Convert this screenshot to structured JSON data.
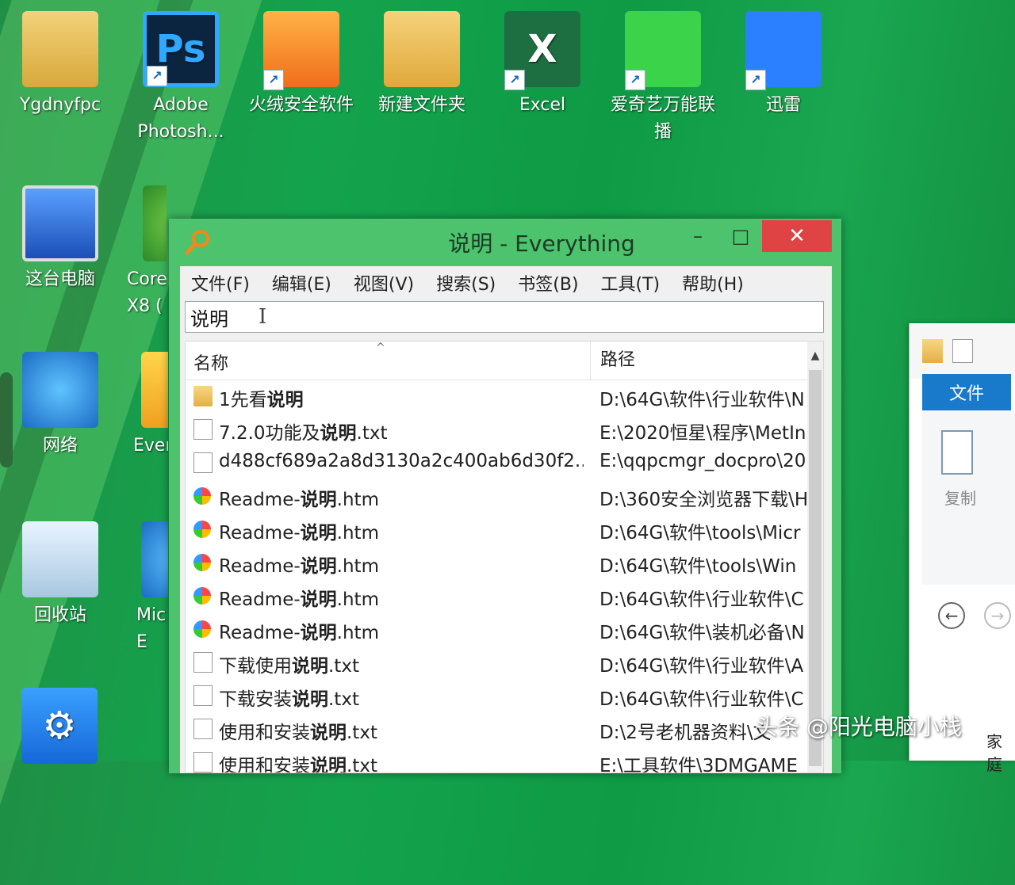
{
  "desktop": {
    "icons": [
      {
        "label": "Ygdnyfpc",
        "icon": "user-folder-icon"
      },
      {
        "label": "Adobe Photosh...",
        "icon": "photoshop-icon",
        "glyph": "Ps"
      },
      {
        "label": "火绒安全软件",
        "icon": "huorong-icon"
      },
      {
        "label": "新建文件夹",
        "icon": "folder-icon"
      },
      {
        "label": "Excel",
        "icon": "excel-icon",
        "glyph": "X"
      },
      {
        "label": "爱奇艺万能联播",
        "icon": "iqiyi-icon"
      },
      {
        "label": "迅雷",
        "icon": "xunlei-icon"
      },
      {
        "label": "这台电脑",
        "icon": "this-pc-icon"
      },
      {
        "label": "Core X8 (",
        "icon": "coreldraw-icon"
      },
      {
        "label": "网络",
        "icon": "network-icon"
      },
      {
        "label": "Ever",
        "icon": "everything-shortcut-icon"
      },
      {
        "label": "回收站",
        "icon": "recycle-bin-icon"
      },
      {
        "label": "Mic E",
        "icon": "edge-icon"
      }
    ]
  },
  "window": {
    "title": "说明 - Everything",
    "controls": {
      "minimize": "–",
      "maximize": "□",
      "close": "✕"
    },
    "menu": [
      "文件(F)",
      "编辑(E)",
      "视图(V)",
      "搜索(S)",
      "书签(B)",
      "工具(T)",
      "帮助(H)"
    ],
    "search": {
      "value": "说明",
      "caret": "I"
    },
    "columns": {
      "name": "名称",
      "path": "路径",
      "sort_indicator": "^"
    },
    "results": [
      {
        "pre": "1先看",
        "bold": "说明",
        "post": "",
        "path": "D:\\64G\\软件\\行业软件\\N",
        "type": "folder"
      },
      {
        "pre": "7.2.0功能及",
        "bold": "说明",
        "post": ".txt",
        "path": "E:\\2020恒星\\程序\\MetIn",
        "type": "txt"
      },
      {
        "pre": "d488cf689a2a8d3130a2c400ab6d30f2...",
        "bold": "",
        "post": "",
        "path": "E:\\qqpcmgr_docpro\\20",
        "type": "file"
      },
      {
        "pre": "Readme-",
        "bold": "说明",
        "post": ".htm",
        "path": "D:\\360安全浏览器下载\\H",
        "type": "htm"
      },
      {
        "pre": "Readme-",
        "bold": "说明",
        "post": ".htm",
        "path": "D:\\64G\\软件\\tools\\Micr",
        "type": "htm"
      },
      {
        "pre": "Readme-",
        "bold": "说明",
        "post": ".htm",
        "path": "D:\\64G\\软件\\tools\\Win",
        "type": "htm"
      },
      {
        "pre": "Readme-",
        "bold": "说明",
        "post": ".htm",
        "path": "D:\\64G\\软件\\行业软件\\C",
        "type": "htm"
      },
      {
        "pre": "Readme-",
        "bold": "说明",
        "post": ".htm",
        "path": "D:\\64G\\软件\\装机必备\\N",
        "type": "htm"
      },
      {
        "pre": "下载使用",
        "bold": "说明",
        "post": ".txt",
        "path": "D:\\64G\\软件\\行业软件\\A",
        "type": "txt"
      },
      {
        "pre": "下载安装",
        "bold": "说明",
        "post": ".txt",
        "path": "D:\\64G\\软件\\行业软件\\C",
        "type": "txt"
      },
      {
        "pre": "使用和安装",
        "bold": "说明",
        "post": ".txt",
        "path": "D:\\2号老机器资料\\文",
        "type": "txt"
      },
      {
        "pre": "使用和安装",
        "bold": "说明",
        "post": ".txt",
        "path": "E:\\工具软件\\3DMGAME",
        "type": "txt"
      }
    ]
  },
  "explorer": {
    "tab_label": "文件",
    "copy_label": "复制",
    "back": "←",
    "forward": "→"
  },
  "watermark": {
    "text": "头条 @阳光电脑小栈",
    "tail": "家庭"
  }
}
